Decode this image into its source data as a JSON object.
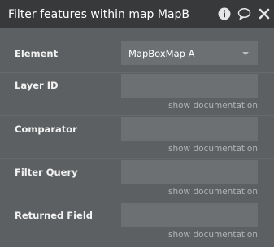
{
  "header": {
    "title": "Filter features within map MapB",
    "icons": [
      "info-icon",
      "comment-icon",
      "close-icon"
    ]
  },
  "fields": [
    {
      "label": "Element",
      "value": "MapBoxMap A",
      "type": "select"
    },
    {
      "label": "Layer ID",
      "value": "",
      "doc_link": "show documentation"
    },
    {
      "label": "Comparator",
      "value": "",
      "doc_link": "show documentation"
    },
    {
      "label": "Filter Query",
      "value": "",
      "doc_link": "show documentation"
    },
    {
      "label": "Returned Field",
      "value": "",
      "doc_link": "show documentation"
    }
  ],
  "colors": {
    "header_bg": "#37393b",
    "panel_bg": "#5d6062",
    "field_bg": "#6d7072"
  }
}
